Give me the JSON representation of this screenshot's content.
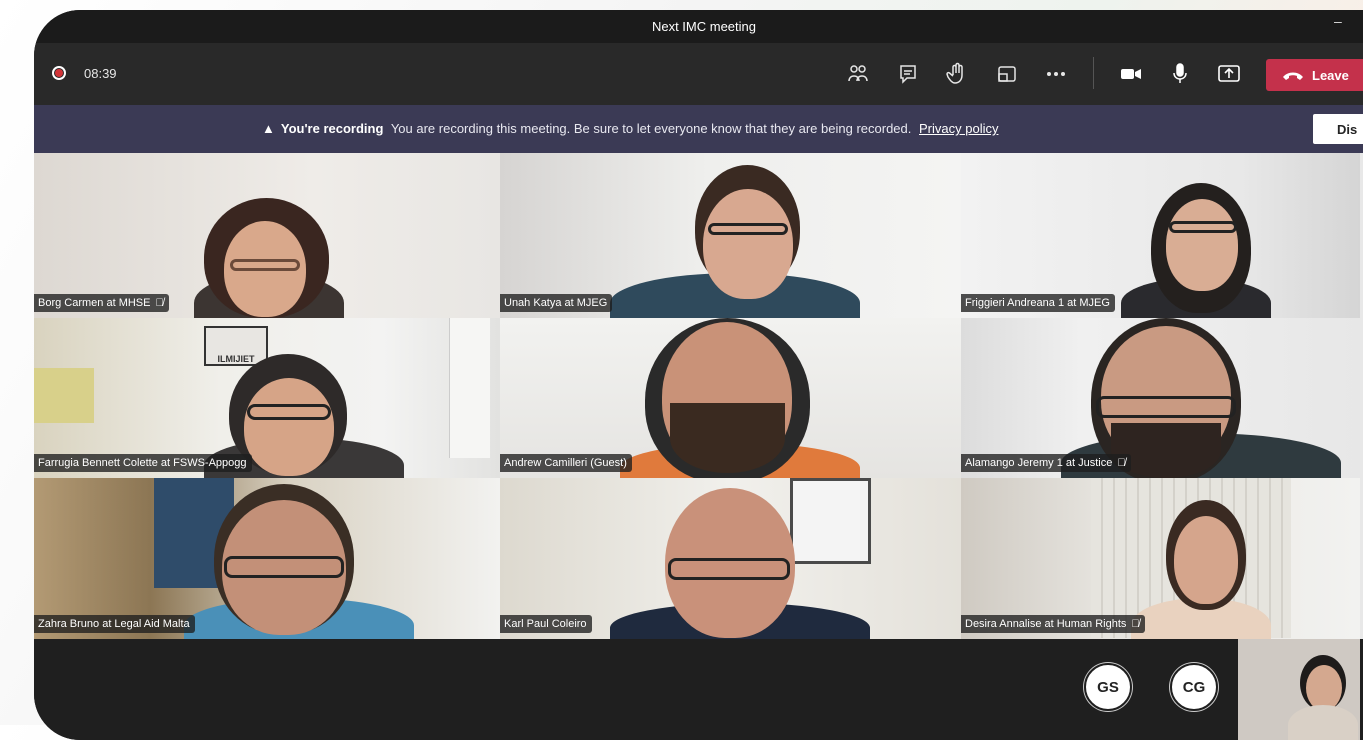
{
  "window": {
    "title": "Next IMC meeting"
  },
  "toolbar": {
    "timer": "08:39",
    "icons": [
      "participants-icon",
      "chat-icon",
      "raise-hand-icon",
      "rooms-icon",
      "more-icon",
      "camera-icon",
      "mic-icon",
      "share-icon"
    ],
    "leave_label": "Leave"
  },
  "banner": {
    "title": "You're recording",
    "message": "You are recording this meeting. Be sure to let everyone know that they are being recorded.",
    "link": "Privacy policy",
    "dismiss_label": "Dis"
  },
  "participants": [
    {
      "name": "Borg Carmen at MHSE",
      "muted": true
    },
    {
      "name": "Unah Katya at MJEG",
      "muted": false
    },
    {
      "name": "Friggieri Andreana 1 at MJEG",
      "muted": false
    },
    {
      "name": "Farrugia Bennett Colette at FSWS-Appogg",
      "muted": false
    },
    {
      "name": "Andrew Camilleri (Guest)",
      "muted": false
    },
    {
      "name": "Alamango Jeremy 1 at Justice",
      "muted": true
    },
    {
      "name": "Zahra Bruno at Legal Aid Malta",
      "muted": false
    },
    {
      "name": "Karl Paul Coleiro",
      "muted": false
    },
    {
      "name": "Desira Annalise at Human Rights",
      "muted": true
    }
  ],
  "wall_sign": "ILMIJIET",
  "bottom": {
    "avatars": [
      "GS",
      "CG"
    ]
  }
}
